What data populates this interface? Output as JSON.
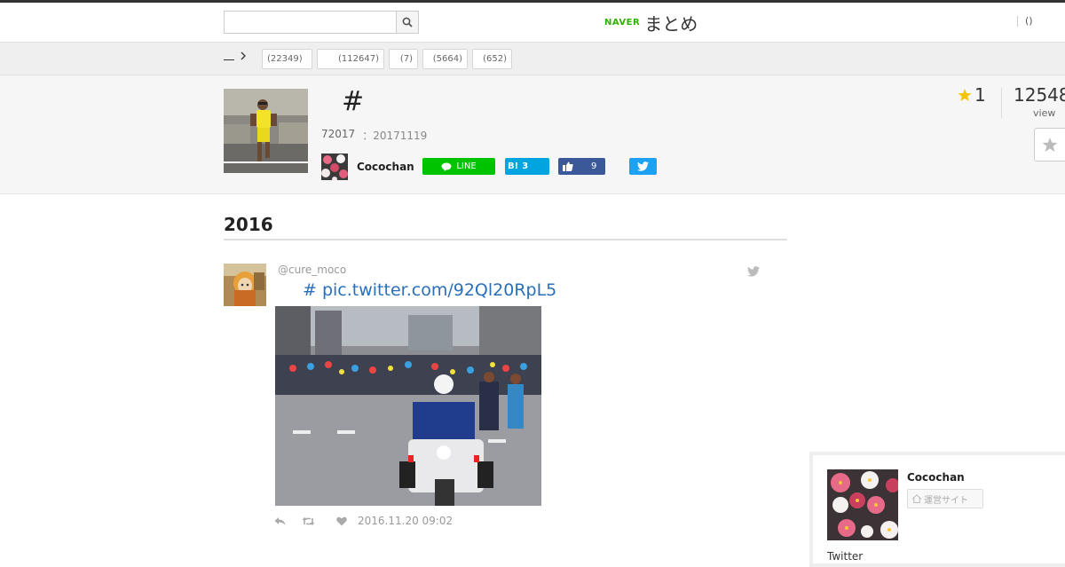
{
  "header": {
    "search": {
      "placeholder": "",
      "value": ""
    },
    "logo": {
      "naver": "NAVER",
      "matome": "まとめ"
    },
    "right_link": "()"
  },
  "category_bar": {
    "breadcrumb_home": "",
    "tags": [
      {
        "label": "(22349)"
      },
      {
        "label": "(112647)"
      },
      {
        "label": "(7)"
      },
      {
        "label": "(5664)"
      },
      {
        "label": "(652)"
      }
    ]
  },
  "article": {
    "title": "#",
    "pv": "72017",
    "updated": "：20171119",
    "author": "Cocochan",
    "share": {
      "line_label": "LINE",
      "hatena_label": "B!",
      "hatena_count": "3",
      "facebook_count": "9"
    },
    "favorites": "1",
    "views": "12548",
    "views_label": "view"
  },
  "content": {
    "section_heading": "2016",
    "tweet": {
      "handle": "@cure_moco",
      "text": "# pic.twitter.com/92Ql20RpL5",
      "date": "2016.11.20 09:02"
    }
  },
  "author_card": {
    "name": "Cocochan",
    "site_button": "運営サイト",
    "twitter_label": "Twitter"
  },
  "colors": {
    "line_green": "#00c300",
    "hatena_blue": "#00a4de",
    "facebook_blue": "#3b5998",
    "twitter_blue": "#1da1f2",
    "link_blue": "#2a6fba",
    "naver_green": "#2db400",
    "star_yellow": "#f5c400"
  }
}
